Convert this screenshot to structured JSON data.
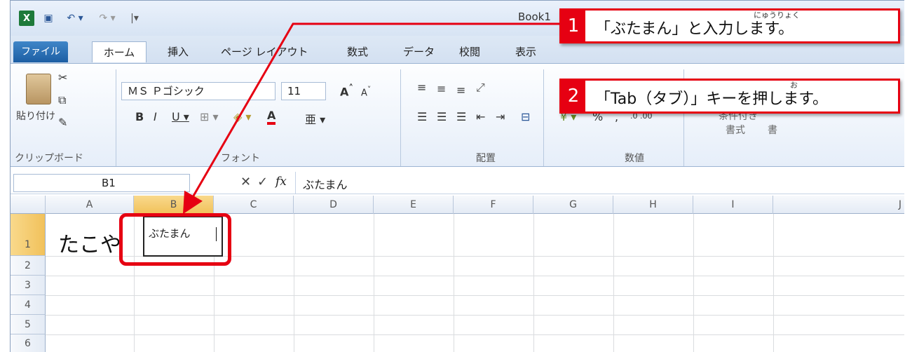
{
  "window": {
    "title": "Book1",
    "quick_access": {
      "app_icon": "excel-icon",
      "save_icon": "save-icon",
      "undo": "↶ ▾",
      "redo": "↷ ▾",
      "customize": "|▾"
    }
  },
  "tabs": [
    "ファイル",
    "ホーム",
    "挿入",
    "ページ レイアウト",
    "数式",
    "データ",
    "校閲",
    "表示"
  ],
  "ribbon": {
    "clipboard": {
      "paste_label": "貼り付け",
      "group_label": "クリップボード"
    },
    "font": {
      "font_name": "ＭＳ Ｐゴシック",
      "font_size": "11",
      "group_label": "フォント"
    },
    "alignment": {
      "group_label": "配置"
    },
    "number": {
      "group_label": "数値",
      "percent": "%",
      "comma": ","
    },
    "styles": {
      "conditional": "条件付き",
      "format_label": "書式",
      "cell_styles": "書"
    }
  },
  "formula_bar": {
    "name_box": "B1",
    "content": "ぶたまん"
  },
  "columns": [
    "A",
    "B",
    "C",
    "D",
    "E",
    "F",
    "G",
    "H",
    "I",
    "J"
  ],
  "rows": [
    "1",
    "2",
    "3",
    "4",
    "5",
    "6"
  ],
  "cells": {
    "A1": "たこや",
    "B1": "ぶたまん"
  },
  "callouts": [
    {
      "number": "1",
      "text": "「ぶたまん」と入力します。",
      "ruby": "にゅうりょく"
    },
    {
      "number": "2",
      "text": "「Tab（タブ）」キーを押します。",
      "ruby": "お"
    }
  ],
  "colors": {
    "annotation_red": "#e60012",
    "file_tab": "#1c5ea3"
  }
}
